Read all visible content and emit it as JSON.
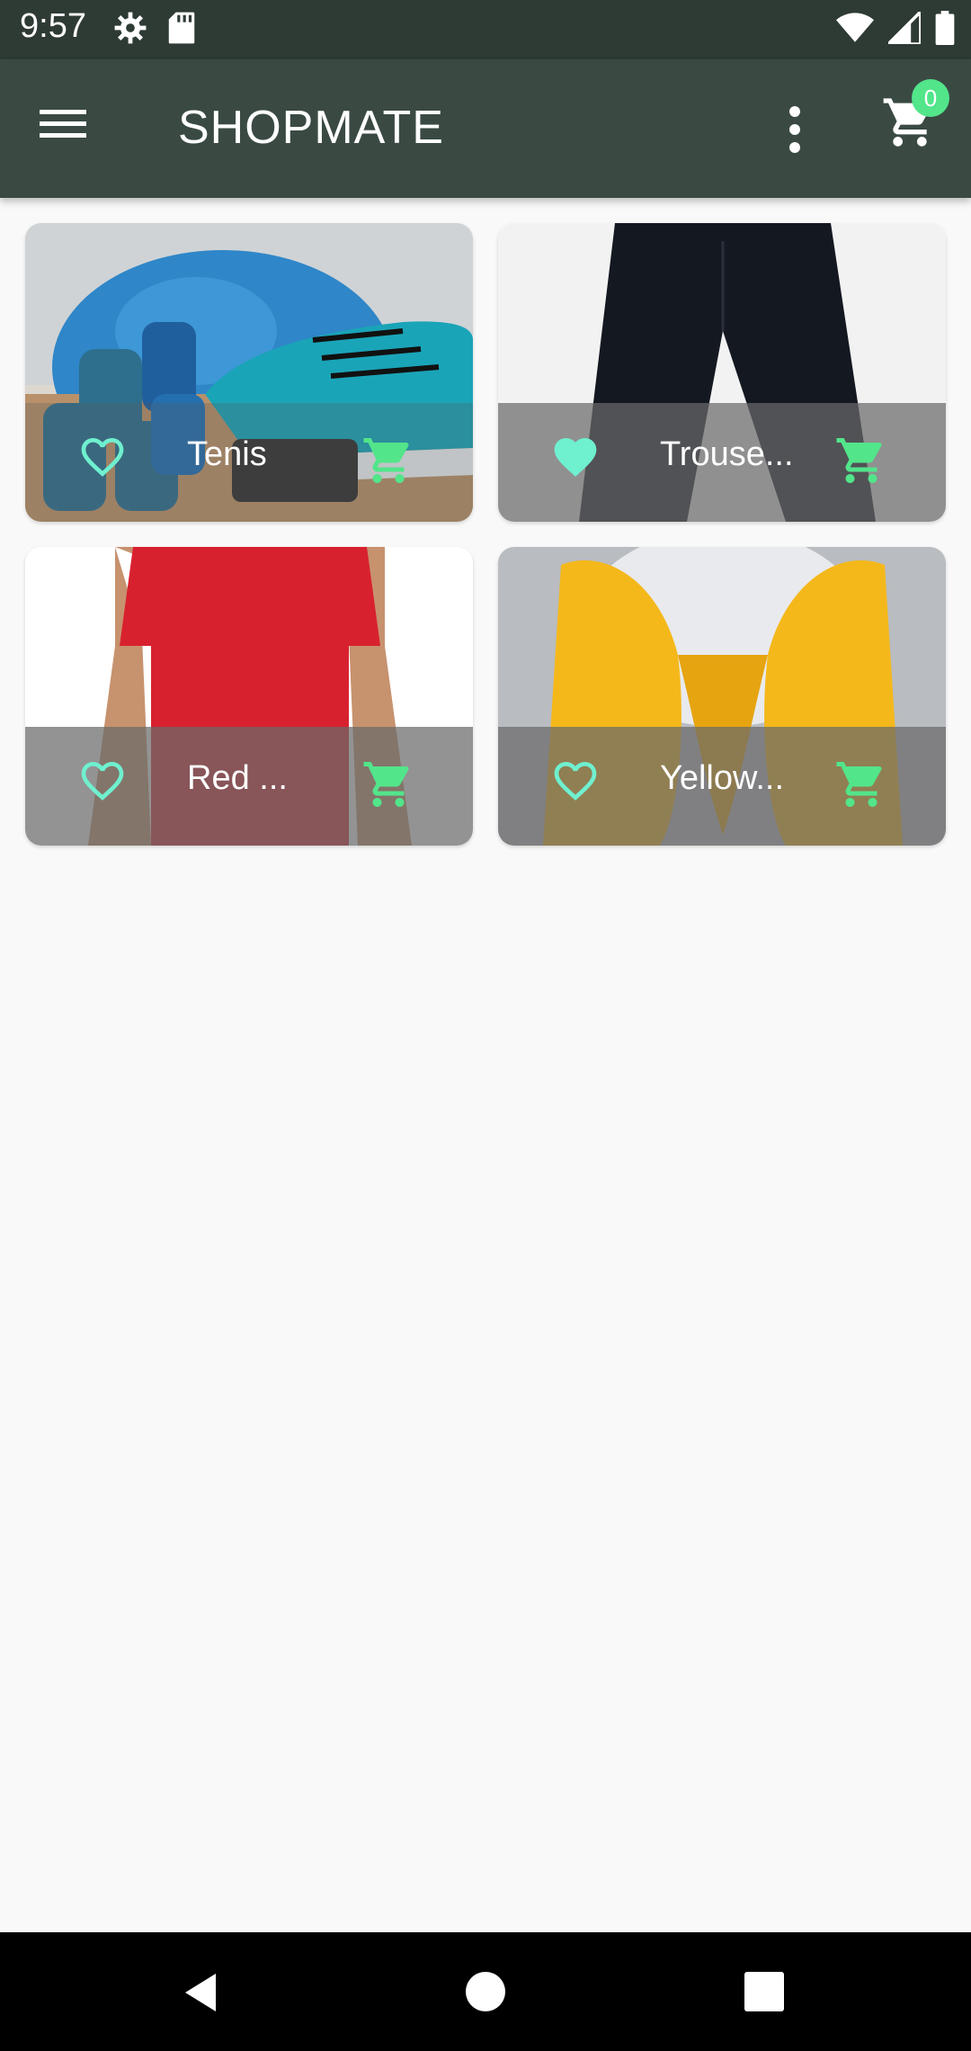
{
  "status_bar": {
    "time": "9:57",
    "icons": [
      "settings-icon",
      "sd-card-icon",
      "wifi-icon",
      "signal-icon",
      "battery-icon"
    ]
  },
  "app_bar": {
    "title": "SHOPMATE",
    "cart_count": "0",
    "icons": [
      "menu-icon",
      "more-vert-icon",
      "shopping-cart-icon"
    ]
  },
  "products": [
    {
      "name": "Tenis",
      "favorite": false
    },
    {
      "name": "Trouse...",
      "favorite": true
    },
    {
      "name": "Red ...",
      "favorite": false
    },
    {
      "name": "Yellow...",
      "favorite": false
    }
  ],
  "colors": {
    "status_bar": "#2e3a34",
    "app_bar": "#3a4a43",
    "accent_green": "#52e58a",
    "favorite_teal": "#6ff0cf",
    "background": "#f9f9f9"
  },
  "nav_bar": {
    "icons": [
      "back-icon",
      "home-icon",
      "recents-icon"
    ]
  }
}
